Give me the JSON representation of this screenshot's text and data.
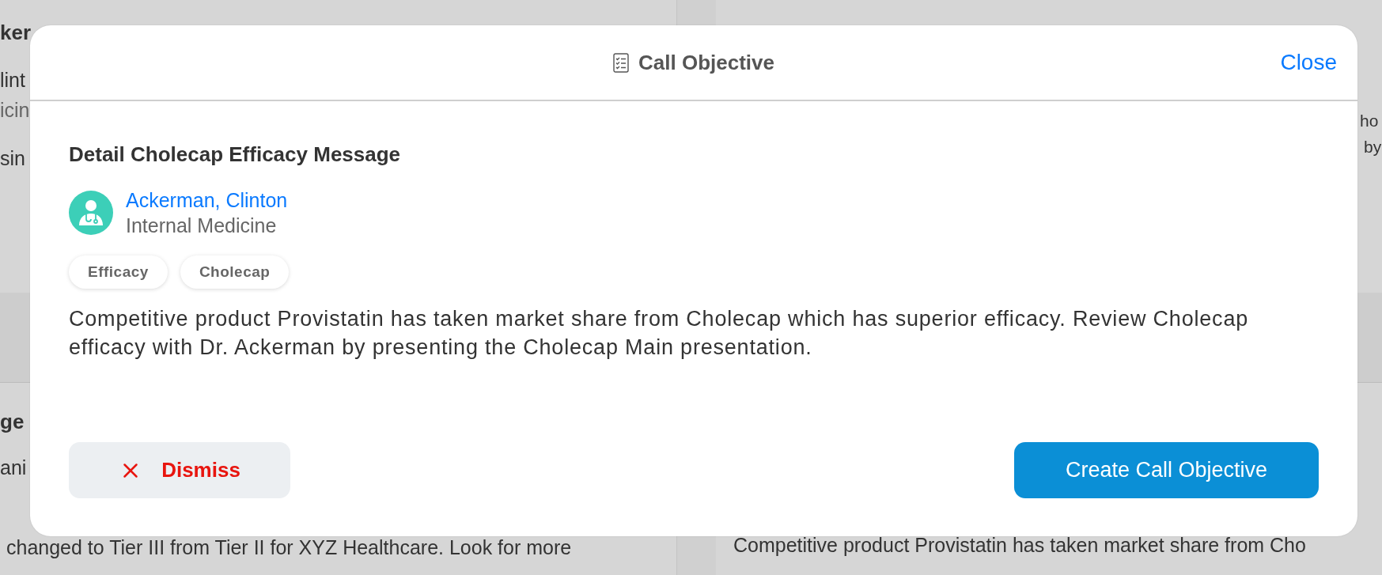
{
  "background": {
    "left_top": {
      "title": "ker",
      "line_1": "lint",
      "line_2": "icin",
      "line_3": "sin"
    },
    "left_bottom": {
      "title": "ge",
      "line_1": "ani",
      "body": [
        "changed to Tier III from Tier II for XYZ Healthcare. Look for more"
      ]
    },
    "right_top": {
      "body": [
        "ho",
        "by"
      ]
    },
    "right_bottom": {
      "body": [
        "Competitive product Provistatin has taken market share from Cho"
      ]
    }
  },
  "dialog": {
    "title": "Call Objective",
    "close": "Close",
    "heading": "Detail Cholecap Efficacy Message",
    "contact": {
      "name": "Ackerman, Clinton",
      "specialty": "Internal Medicine"
    },
    "tags": [
      "Efficacy",
      "Cholecap"
    ],
    "description": "Competitive product Provistatin has taken market share from Cholecap which has superior efficacy. Review Cholecap efficacy with Dr. Ackerman by presenting the Cholecap Main presentation.",
    "buttons": [
      {
        "kind": "dismiss",
        "label": "Dismiss"
      },
      {
        "kind": "primary",
        "label": "Create Call Objective"
      }
    ]
  }
}
